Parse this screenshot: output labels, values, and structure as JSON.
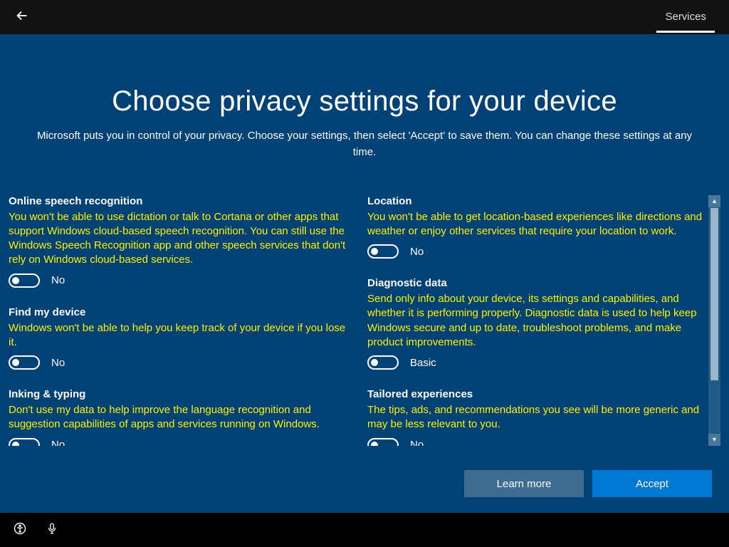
{
  "header": {
    "tab_label": "Services"
  },
  "page": {
    "title": "Choose privacy settings for your device",
    "subtitle": "Microsoft puts you in control of your privacy. Choose your settings, then select 'Accept' to save them. You can change these settings at any time."
  },
  "settings": {
    "speech": {
      "title": "Online speech recognition",
      "desc": "You won't be able to use dictation or talk to Cortana or other apps that support Windows cloud-based speech recognition. You can still use the Windows Speech Recognition app and other speech services that don't rely on Windows cloud-based services.",
      "value_label": "No"
    },
    "find_device": {
      "title": "Find my device",
      "desc": "Windows won't be able to help you keep track of your device if you lose it.",
      "value_label": "No"
    },
    "inking": {
      "title": "Inking & typing",
      "desc": "Don't use my data to help improve the language recognition and suggestion capabilities of apps and services running on Windows.",
      "value_label": "No"
    },
    "location": {
      "title": "Location",
      "desc": "You won't be able to get location-based experiences like directions and weather or enjoy other services that require your location to work.",
      "value_label": "No"
    },
    "diagnostic": {
      "title": "Diagnostic data",
      "desc": "Send only info about your device, its settings and capabilities, and whether it is performing properly. Diagnostic data is used to help keep Windows secure and up to date, troubleshoot problems, and make product improvements.",
      "value_label": "Basic"
    },
    "tailored": {
      "title": "Tailored experiences",
      "desc": "The tips, ads, and recommendations you see will be more generic and may be less relevant to you.",
      "value_label": "No"
    }
  },
  "buttons": {
    "learn_more": "Learn more",
    "accept": "Accept"
  }
}
